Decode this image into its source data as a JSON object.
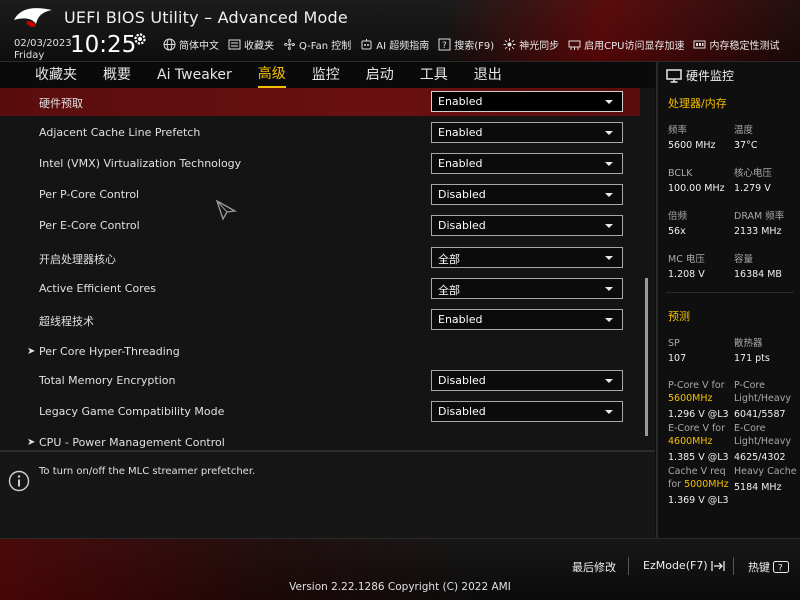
{
  "header": {
    "title": "UEFI BIOS Utility – Advanced Mode",
    "date": "02/03/2023",
    "weekday": "Friday",
    "time": "10:25",
    "logo_icon": "rog-eye-logo",
    "toolbar": [
      {
        "icon": "globe-icon",
        "label": "简体中文"
      },
      {
        "icon": "favorites-icon",
        "label": "收藏夹"
      },
      {
        "icon": "fan-icon",
        "label": "Q-Fan 控制"
      },
      {
        "icon": "ai-icon",
        "label": "AI 超频指南"
      },
      {
        "icon": "help-search-icon",
        "label": "搜索(F9)"
      },
      {
        "icon": "sync-icon",
        "label": "神光同步"
      },
      {
        "icon": "memory-icon",
        "label": "启用CPU访问显存加速"
      },
      {
        "icon": "memory-test-icon",
        "label": "内存稳定性测试"
      }
    ]
  },
  "tabs": [
    "收藏夹",
    "概要",
    "Ai Tweaker",
    "高级",
    "监控",
    "启动",
    "工具",
    "退出"
  ],
  "active_tab": "高级",
  "settings": [
    {
      "label": "硬件预取",
      "value": "Enabled",
      "type": "dropdown"
    },
    {
      "label": "Adjacent Cache Line Prefetch",
      "value": "Enabled",
      "type": "dropdown"
    },
    {
      "label": "Intel (VMX) Virtualization Technology",
      "value": "Enabled",
      "type": "dropdown"
    },
    {
      "label": "Per P-Core Control",
      "value": "Disabled",
      "type": "dropdown"
    },
    {
      "label": "Per E-Core Control",
      "value": "Disabled",
      "type": "dropdown"
    },
    {
      "label": "开启处理器核心",
      "value": "全部",
      "type": "dropdown"
    },
    {
      "label": "Active Efficient Cores",
      "value": "全部",
      "type": "dropdown"
    },
    {
      "label": "超线程技术",
      "value": "Enabled",
      "type": "dropdown"
    },
    {
      "label": "Per Core Hyper-Threading",
      "type": "submenu"
    },
    {
      "label": "Total Memory Encryption",
      "value": "Disabled",
      "type": "dropdown"
    },
    {
      "label": "Legacy Game Compatibility Mode",
      "value": "Disabled",
      "type": "dropdown"
    },
    {
      "label": "CPU - Power Management Control",
      "type": "submenu"
    }
  ],
  "help_text": "To turn on/off the MLC streamer prefetcher.",
  "monitor": {
    "title": "硬件监控",
    "cpu_section": "处理器/内存",
    "cpu_fields": [
      {
        "label": "频率",
        "value": "5600 MHz"
      },
      {
        "label": "温度",
        "value": "37°C"
      },
      {
        "label": "BCLK",
        "value": "100.00 MHz"
      },
      {
        "label": "核心电压",
        "value": "1.279 V"
      },
      {
        "label": "倍频",
        "value": "56x"
      },
      {
        "label": "DRAM 频率",
        "value": "2133 MHz"
      },
      {
        "label": "MC 电压",
        "value": "1.208 V"
      },
      {
        "label": "容量",
        "value": "16384 MB"
      }
    ],
    "predict_section": "预测",
    "predict": {
      "sp_label": "SP",
      "sp_value": "107",
      "cooler_label": "散热器",
      "cooler_value": "171 pts",
      "pcore_label": "P-Core V for",
      "pcore_freq": "5600MHz",
      "pcore_value": "1.296 V @L3",
      "pcore_lh_label": "P-Core",
      "pcore_lh_label2": "Light/Heavy",
      "pcore_lh_value": "6041/5587",
      "ecore_label": "E-Core V for",
      "ecore_freq": "4600MHz",
      "ecore_value": "1.385 V @L3",
      "ecore_lh_label": "E-Core",
      "ecore_lh_label2": "Light/Heavy",
      "ecore_lh_value": "4625/4302",
      "cache_label": "Cache V req",
      "cache_label2": "for",
      "cache_freq": "5000MHz",
      "cache_value": "1.369 V @L3",
      "heavy_label": "Heavy Cache",
      "heavy_value": "5184 MHz"
    }
  },
  "footer": {
    "last_modified": "最后修改",
    "ezmode": "EzMode(F7)",
    "hotkeys": "热键",
    "version": "Version 2.22.1286 Copyright (C) 2022 AMI"
  },
  "colors": {
    "accent": "#f5c000",
    "selection": "#6b1010",
    "background": "#141414"
  }
}
